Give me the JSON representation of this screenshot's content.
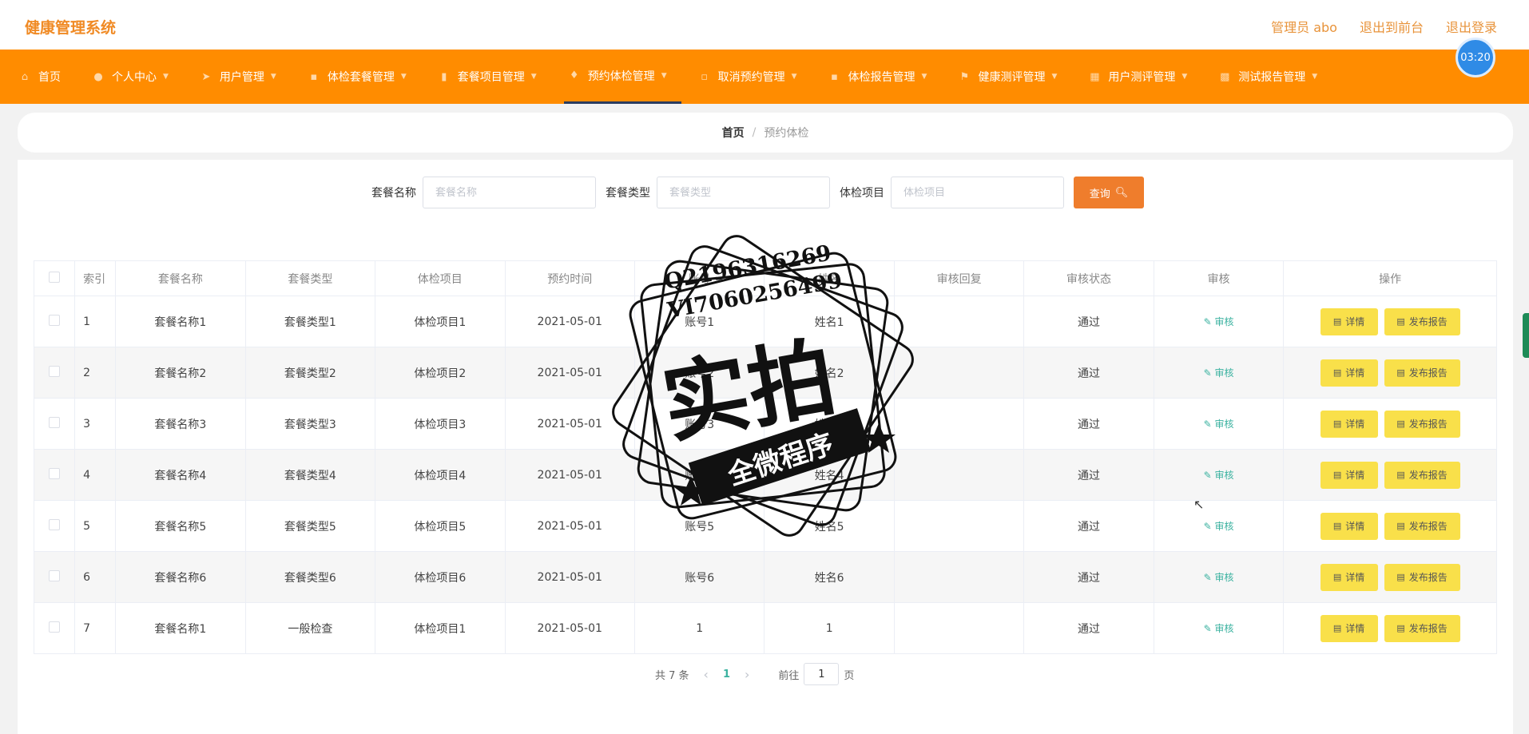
{
  "header": {
    "brand": "健康管理系统",
    "admin_label": "管理员 abo",
    "to_front": "退出到前台",
    "logout": "退出登录",
    "timer": "03:20"
  },
  "nav": [
    {
      "label": "首页",
      "icon": "home-icon",
      "glyph": "⌂",
      "caret": false
    },
    {
      "label": "个人中心",
      "icon": "user-icon",
      "glyph": "●",
      "caret": true
    },
    {
      "label": "用户管理",
      "icon": "send-icon",
      "glyph": "➤",
      "caret": true
    },
    {
      "label": "体检套餐管理",
      "icon": "chat-icon",
      "glyph": "▪",
      "caret": true
    },
    {
      "label": "套餐项目管理",
      "icon": "bar-chart-icon",
      "glyph": "▮",
      "caret": true
    },
    {
      "label": "预约体检管理",
      "icon": "pin-icon",
      "glyph": "♦",
      "caret": true,
      "active": true
    },
    {
      "label": "取消预约管理",
      "icon": "message-icon",
      "glyph": "▫",
      "caret": true
    },
    {
      "label": "体检报告管理",
      "icon": "comment-icon",
      "glyph": "▪",
      "caret": true
    },
    {
      "label": "健康测评管理",
      "icon": "flag-icon",
      "glyph": "⚑",
      "caret": true
    },
    {
      "label": "用户测评管理",
      "icon": "calendar-icon",
      "glyph": "▦",
      "caret": true
    },
    {
      "label": "测试报告管理",
      "icon": "document-icon",
      "glyph": "▩",
      "caret": true
    }
  ],
  "breadcrumb": {
    "home": "首页",
    "separator": "/",
    "current": "预约体检"
  },
  "search": {
    "fields": [
      {
        "label": "套餐名称",
        "placeholder": "套餐名称"
      },
      {
        "label": "套餐类型",
        "placeholder": "套餐类型"
      },
      {
        "label": "体检项目",
        "placeholder": "体检项目"
      }
    ],
    "button": "查询"
  },
  "table": {
    "columns": [
      "索引",
      "套餐名称",
      "套餐类型",
      "体检项目",
      "预约时间",
      "账号",
      "姓名",
      "审核回复",
      "审核状态",
      "审核",
      "操作"
    ],
    "rows": [
      {
        "idx": "1",
        "name": "套餐名称1",
        "type": "套餐类型1",
        "item": "体检项目1",
        "time": "2021-05-01",
        "account": "账号1",
        "person": "姓名1",
        "reply": "",
        "status": "通过"
      },
      {
        "idx": "2",
        "name": "套餐名称2",
        "type": "套餐类型2",
        "item": "体检项目2",
        "time": "2021-05-01",
        "account": "账号2",
        "person": "姓名2",
        "reply": "",
        "status": "通过"
      },
      {
        "idx": "3",
        "name": "套餐名称3",
        "type": "套餐类型3",
        "item": "体检项目3",
        "time": "2021-05-01",
        "account": "账号3",
        "person": "姓名3",
        "reply": "",
        "status": "通过"
      },
      {
        "idx": "4",
        "name": "套餐名称4",
        "type": "套餐类型4",
        "item": "体检项目4",
        "time": "2021-05-01",
        "account": "账号4",
        "person": "姓名4",
        "reply": "",
        "status": "通过"
      },
      {
        "idx": "5",
        "name": "套餐名称5",
        "type": "套餐类型5",
        "item": "体检项目5",
        "time": "2021-05-01",
        "account": "账号5",
        "person": "姓名5",
        "reply": "",
        "status": "通过"
      },
      {
        "idx": "6",
        "name": "套餐名称6",
        "type": "套餐类型6",
        "item": "体检项目6",
        "time": "2021-05-01",
        "account": "账号6",
        "person": "姓名6",
        "reply": "",
        "status": "通过"
      },
      {
        "idx": "7",
        "name": "套餐名称1",
        "type": "一般检查",
        "item": "体检项目1",
        "time": "2021-05-01",
        "account": "1",
        "person": "1",
        "reply": "",
        "status": "通过"
      }
    ],
    "audit_label": "审核",
    "detail_label": "详情",
    "report_label": "发布报告"
  },
  "pagination": {
    "total": "共 7 条",
    "page": "1",
    "goto_label": "前往",
    "goto_value": "1",
    "page_suffix": "页"
  },
  "watermark": {
    "line1": "Q2196316269",
    "line2": "VI7060256499",
    "big": "实拍",
    "band": "全微程序"
  }
}
